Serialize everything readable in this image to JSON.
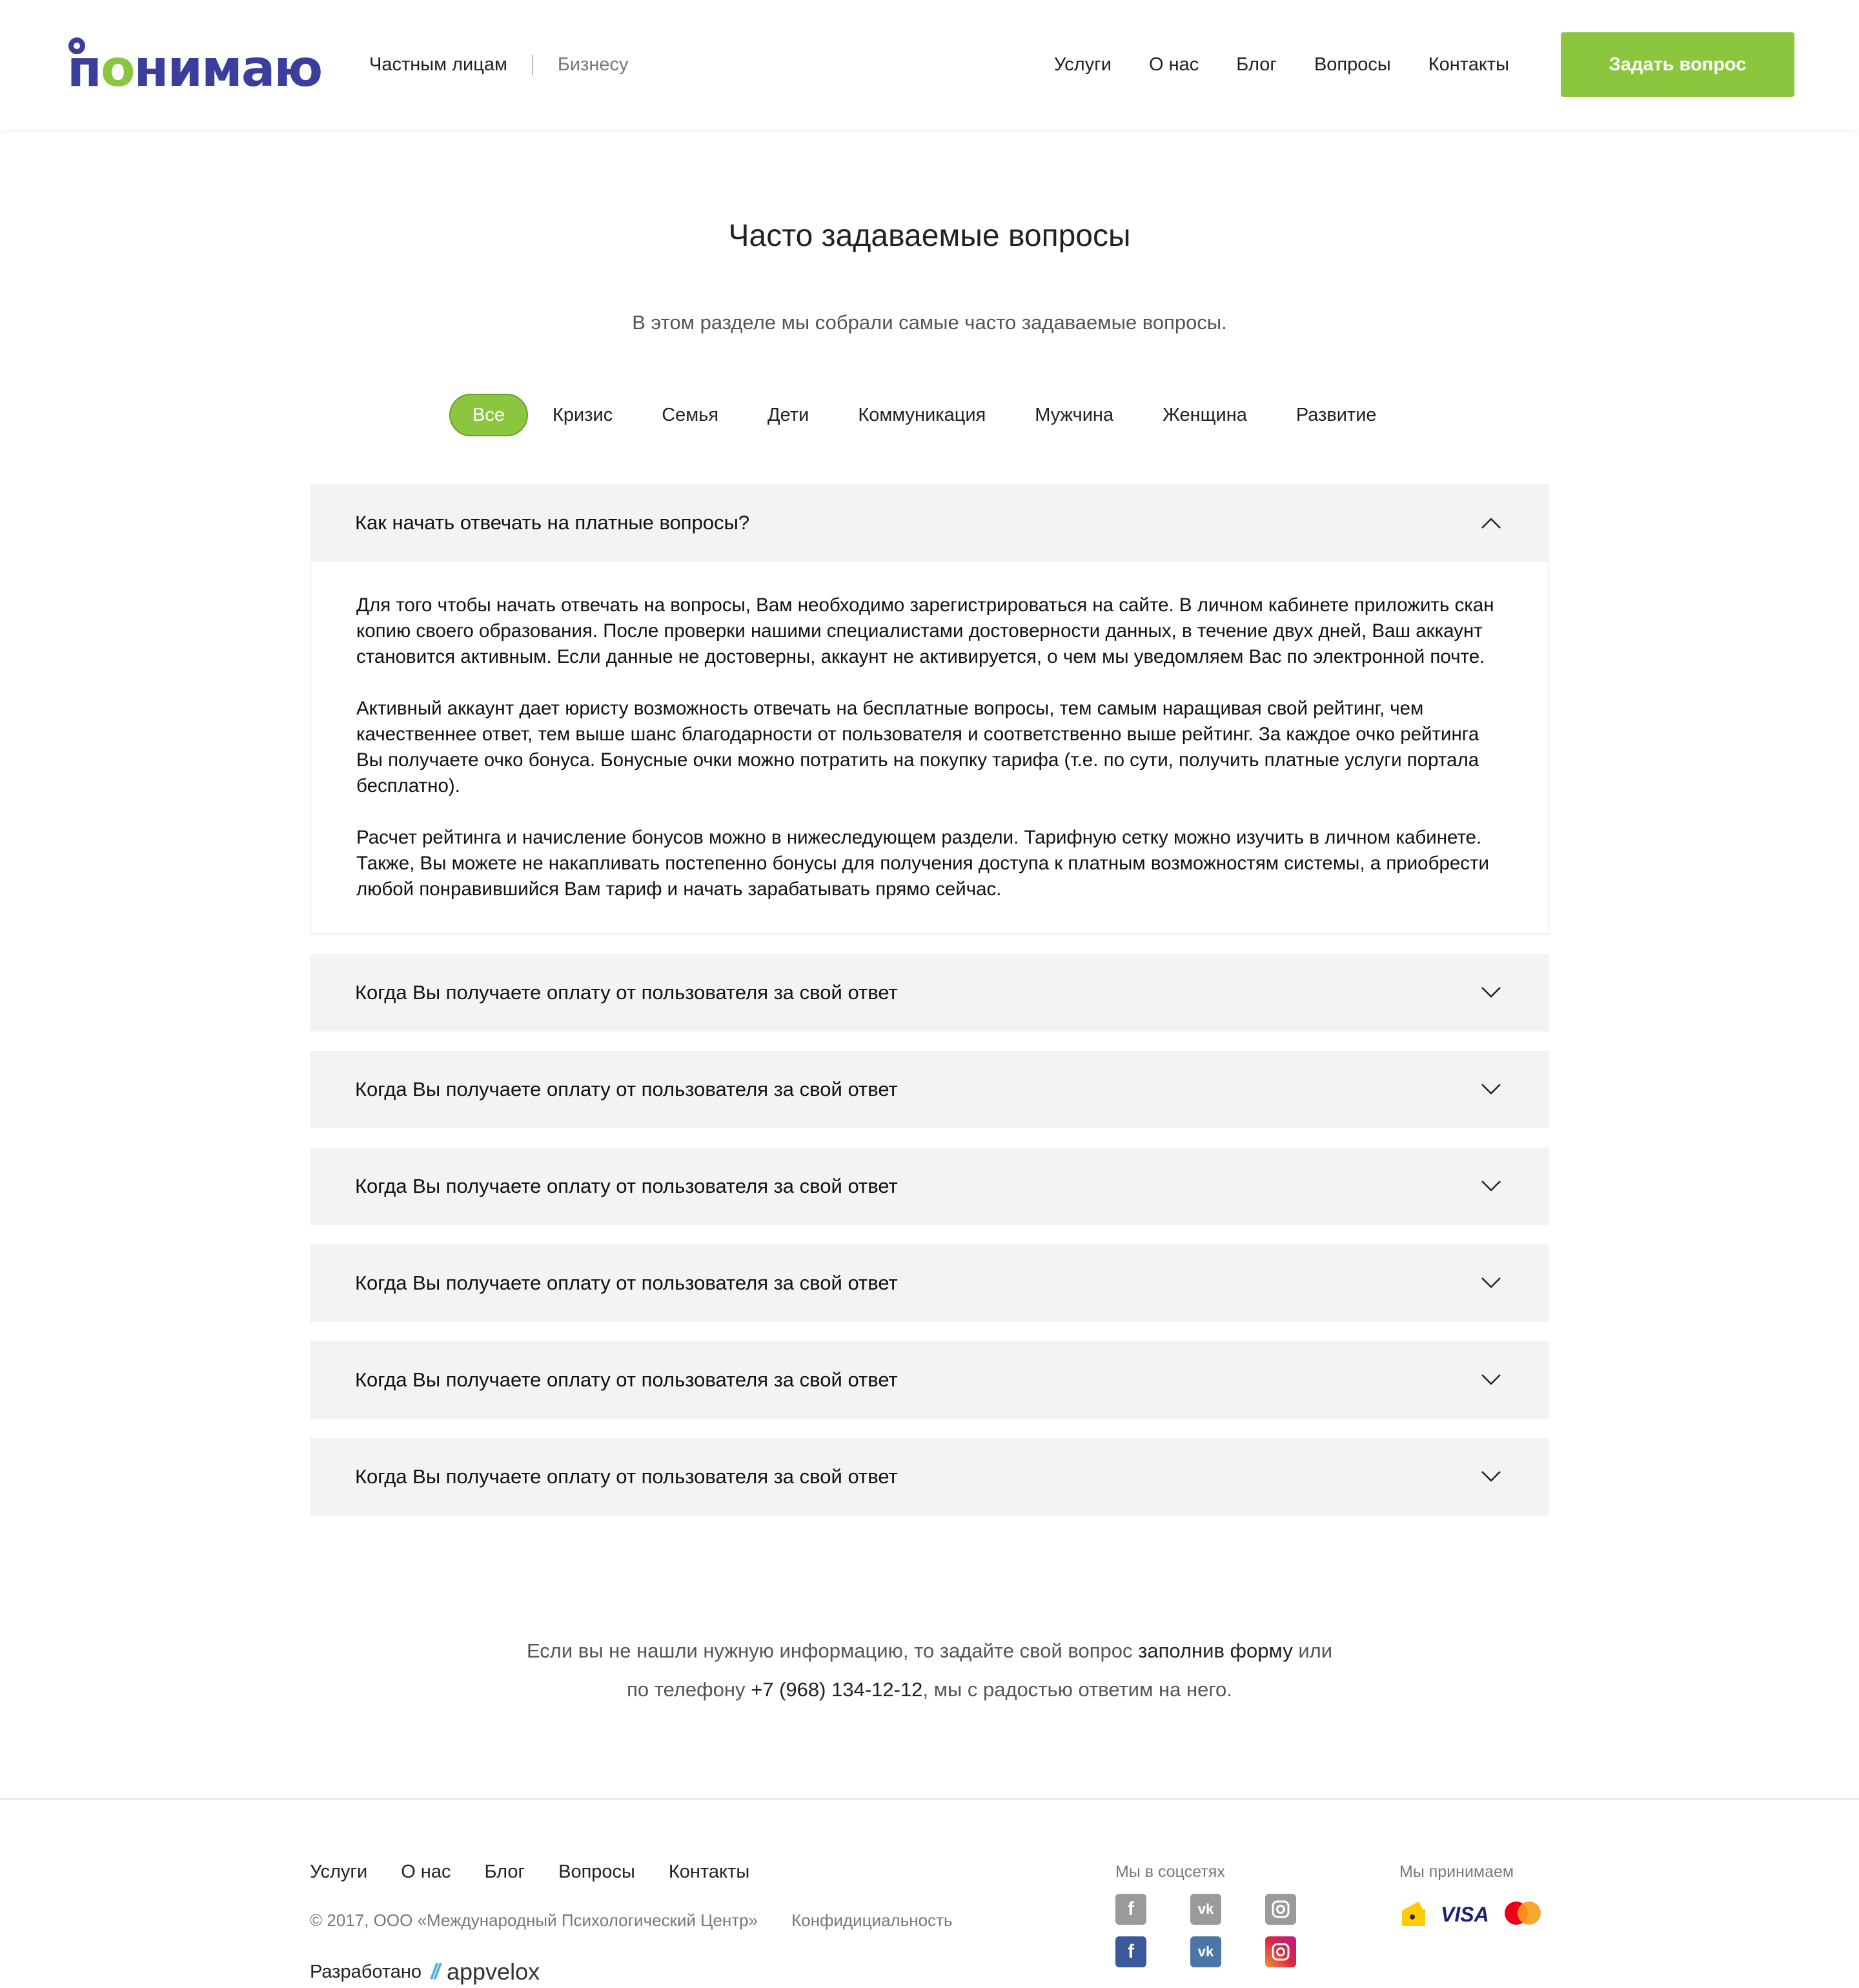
{
  "header": {
    "logo_text_1": "п",
    "logo_text_2": "о",
    "logo_text_3": "нимаю",
    "audience_private": "Частным лицам",
    "audience_business": "Бизнесу",
    "nav": [
      "Услуги",
      "О нас",
      "Блог",
      "Вопросы",
      "Контакты"
    ],
    "cta_label": "Задать вопрос"
  },
  "page": {
    "title": "Часто задаваемые вопросы",
    "subtitle": "В этом разделе мы собрали самые часто задаваемые вопросы."
  },
  "filters": [
    "Все",
    "Кризис",
    "Семья",
    "Дети",
    "Коммуникация",
    "Мужчина",
    "Женщина",
    "Развитие"
  ],
  "faq": {
    "open_question": "Как начать отвечать на платные вопросы?",
    "open_answer": [
      "Для того чтобы начать отвечать на вопросы, Вам необходимо зарегистрироваться на сайте. В личном кабинете приложить скан копию своего образования. После проверки нашими специалистами достоверности данных, в течение двух дней, Ваш аккаунт становится активным. Если данные не достоверны, аккаунт не активируется, о чем мы уведомляем Вас по электронной почте.",
      "Активный аккаунт дает юристу возможность отвечать на бесплатные вопросы, тем самым наращивая свой рейтинг, чем качественнее ответ, тем выше шанс благодарности от пользователя и соответственно выше рейтинг. За каждое очко рейтинга Вы получаете очко бонуса. Бонусные очки можно потратить на покупку тарифа (т.е. по сути, получить платные услуги портала бесплатно).",
      "Расчет рейтинга и начисление бонусов можно в нижеследующем раздели. Тарифную сетку можно изучить в личном кабинете.",
      "Также, Вы можете не накапливать постепенно бонусы для получения доступа к платным возможностям системы, а приобрести любой понравившийся Вам тариф и начать зарабатывать прямо сейчас."
    ],
    "collapsed": [
      "Когда Вы получаете оплату от пользователя за свой ответ",
      "Когда Вы получаете оплату от пользователя за свой ответ",
      "Когда Вы получаете оплату от пользователя за свой ответ",
      "Когда Вы получаете оплату от пользователя за свой ответ",
      "Когда Вы получаете оплату от пользователя за свой ответ",
      "Когда Вы получаете оплату от пользователя за свой ответ"
    ]
  },
  "contact": {
    "part1": "Если вы не нашли нужную информацию, то задайте свой вопрос ",
    "link": "заполнив форму",
    "part2": " или",
    "part3": "по телефону ",
    "phone": "+7 (968) 134-12-12",
    "part4": ", мы с радостью ответим на него."
  },
  "footer": {
    "nav": [
      "Услуги",
      "О нас",
      "Блог",
      "Вопросы",
      "Контакты"
    ],
    "copyright": "© 2017, ООО «Международный Психологический Центр»",
    "privacy": "Конфидициальность",
    "developed_by": "Разработано",
    "dev_slashes": "//",
    "dev_brand": "appvelox",
    "social_title": "Мы в соцсетях",
    "payments_title": "Мы принимаем",
    "visa": "VISA"
  },
  "colors": {
    "accent": "#8cc63f",
    "brand": "#3b3f9b"
  }
}
